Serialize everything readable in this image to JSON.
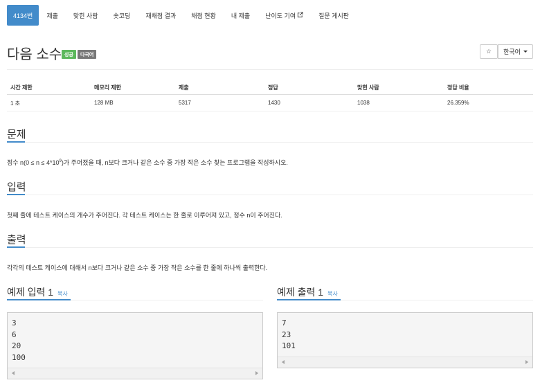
{
  "tabs": [
    {
      "label": "4134번",
      "active": true
    },
    {
      "label": "제출"
    },
    {
      "label": "맞힌 사람"
    },
    {
      "label": "숏코딩"
    },
    {
      "label": "재채점 결과"
    },
    {
      "label": "채점 현황"
    },
    {
      "label": "내 제출"
    },
    {
      "label": "난이도 기여"
    },
    {
      "label": "질문 게시판"
    }
  ],
  "problem": {
    "title": "다음 소수",
    "badges": [
      "성공",
      "다국어"
    ],
    "star_icon": "☆",
    "language": "한국어"
  },
  "stats": {
    "headers": [
      "시간 제한",
      "메모리 제한",
      "제출",
      "정답",
      "맞힌 사람",
      "정답 비율"
    ],
    "values": [
      "1 초",
      "128 MB",
      "5317",
      "1430",
      "1038",
      "26.359%"
    ]
  },
  "sections": {
    "problem": {
      "heading": "문제",
      "text_before": "정수 n(0 ≤ n ≤ 4*10",
      "sup": "9",
      "text_after": ")가 주어졌을 때, n보다 크거나 같은 소수 중 가장 작은 소수 찾는 프로그램을 작성하시오."
    },
    "input": {
      "heading": "입력",
      "text": "첫째 줄에 테스트 케이스의 개수가 주어진다. 각 테스트 케이스는 한 줄로 이루어져 있고, 정수 n이 주어진다."
    },
    "output": {
      "heading": "출력",
      "text": "각각의 테스트 케이스에 대해서 n보다 크거나 같은 소수 중 가장 작은 소수를 한 줄에 하나씩 출력한다."
    }
  },
  "samples": {
    "input": {
      "heading": "예제 입력 1",
      "copy": "복사",
      "lines": [
        "3",
        "6",
        "20",
        "100"
      ]
    },
    "output": {
      "heading": "예제 출력 1",
      "copy": "복사",
      "lines": [
        "7",
        "23",
        "101"
      ]
    }
  },
  "colors": {
    "accent": "#428bca",
    "success": "#5cb85c",
    "muted": "#777777"
  }
}
